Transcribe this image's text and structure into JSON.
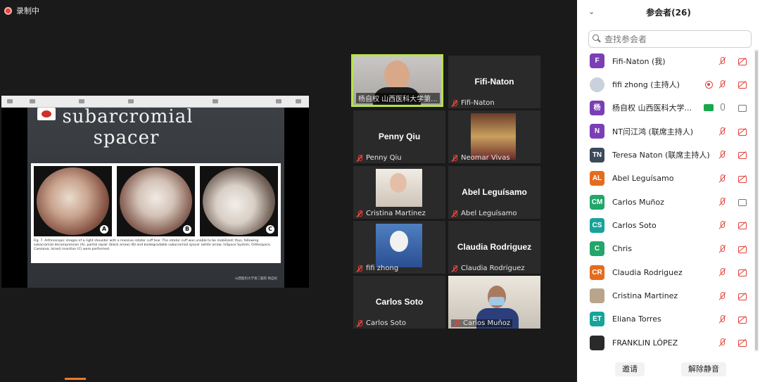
{
  "recording": {
    "label": "录制中"
  },
  "slide": {
    "title_line1": "subarcromial",
    "title_line2": "spacer",
    "photo_labels": [
      "A",
      "B",
      "C"
    ],
    "caption": "Fig. 7. Arthroscopic images of a right shoulder with a massive rotator cuff tear. The rotator cuff was unable to be mobilized; thus, following subacromial decompression (A), partial repair (black arrow) (B) and biodegradable subacromial spacer (white arrow; InSpace System, Orthospace, Caesarea, Israel) insertion (C) were performed.",
    "footer": "山西医科大学第二医院 杨自权"
  },
  "tiles": [
    {
      "name": "杨自权 山西医科大学第...",
      "big": ""
    },
    {
      "name": "Fifi-Naton",
      "big": "Fifi-Naton"
    },
    {
      "name": "Penny Qiu",
      "big": "Penny Qiu"
    },
    {
      "name": "Neomar Vivas",
      "big": ""
    },
    {
      "name": "Cristina Martinez",
      "big": ""
    },
    {
      "name": "Abel Leguísamo",
      "big": "Abel Leguísamo"
    },
    {
      "name": "fifi zhong",
      "big": ""
    },
    {
      "name": "Claudia Rodriguez",
      "big": "Claudia Rodriguez"
    },
    {
      "name": "Carlos Soto",
      "big": "Carlos Soto"
    },
    {
      "name": "Carlos Muñoz",
      "big": ""
    }
  ],
  "panel": {
    "title": "参会者(26)",
    "search_placeholder": "查找参会者",
    "participants": [
      {
        "initials": "F",
        "color": "#7b3fb5",
        "name": "Fifi-Naton (我)"
      },
      {
        "initials": "",
        "color": "#c9d2dc",
        "name": "fifi zhong (主持人)"
      },
      {
        "initials": "杨",
        "color": "#7b3fb5",
        "name": "杨自权 山西医科大学..."
      },
      {
        "initials": "N",
        "color": "#7b3fb5",
        "name": "NT闫江鸿 (联席主持人)"
      },
      {
        "initials": "TN",
        "color": "#3a4a5c",
        "name": "Teresa  Naton (联席主持人)"
      },
      {
        "initials": "AL",
        "color": "#e46c1e",
        "name": "Abel Leguísamo"
      },
      {
        "initials": "CM",
        "color": "#22a66a",
        "name": "Carlos Muñoz"
      },
      {
        "initials": "CS",
        "color": "#17a39a",
        "name": "Carlos Soto"
      },
      {
        "initials": "C",
        "color": "#22a66a",
        "name": "Chris"
      },
      {
        "initials": "CR",
        "color": "#e46c1e",
        "name": "Claudia Rodriguez"
      },
      {
        "initials": "",
        "color": "#b9a58c",
        "name": "Cristina Martinez"
      },
      {
        "initials": "ET",
        "color": "#17a39a",
        "name": "Eliana Torres"
      },
      {
        "initials": "",
        "color": "#2a2a2a",
        "name": "FRANKLIN LÓPEZ"
      }
    ],
    "invite_label": "邀请",
    "unmute_label": "解除静音"
  }
}
